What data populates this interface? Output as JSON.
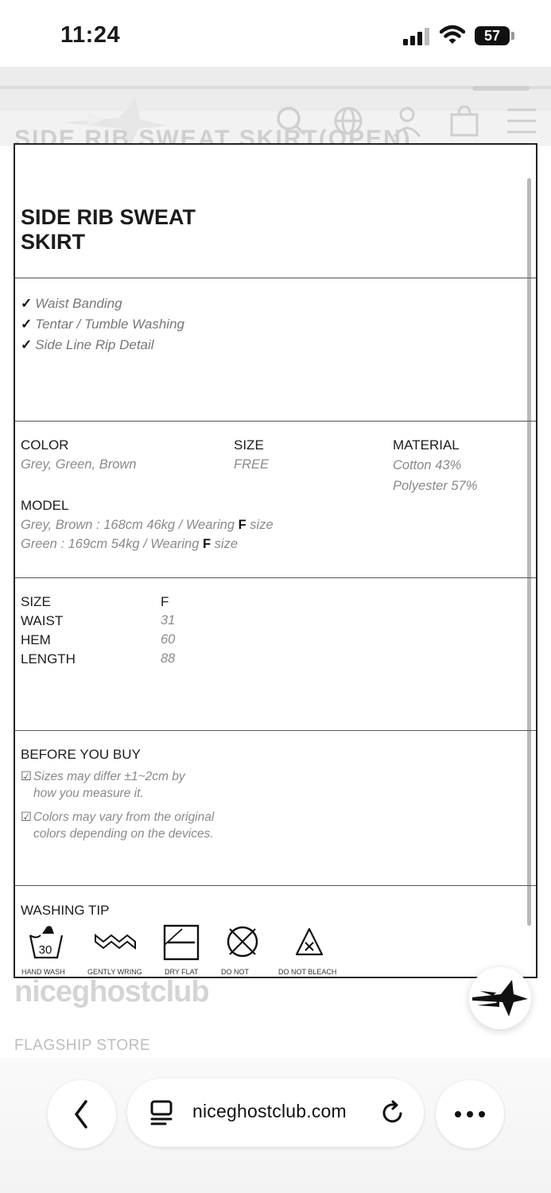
{
  "status_bar": {
    "time": "11:24",
    "battery": "57"
  },
  "site": {
    "header_ghost_text": "SIDE RIB SWEAT SKIRT(OPEN)",
    "brand_ghost": "niceghostclub",
    "flagship_label": "FLAGSHIP STORE"
  },
  "product": {
    "title": "SIDE RIB SWEAT SKIRT",
    "features": [
      "Waist Banding",
      "Tentar / Tumble Washing",
      "Side Line Rip Detail"
    ],
    "check": "✓"
  },
  "info": {
    "color_label": "COLOR",
    "color_value": "Grey, Green, Brown",
    "size_label": "SIZE",
    "size_value": "FREE",
    "material_label": "MATERIAL",
    "material_values": [
      "Cotton 43%",
      "Polyester 57%"
    ],
    "model_label": "MODEL",
    "model_lines": [
      {
        "prefix": "Grey, Brown : 168cm 46kg / Wearing ",
        "size": "F",
        "suffix": " size"
      },
      {
        "prefix": "Green : 169cm 54kg / Wearing ",
        "size": "F",
        "suffix": " size"
      }
    ]
  },
  "size_table": {
    "header_label": "SIZE",
    "header_value": "F",
    "rows": [
      {
        "label": "WAIST",
        "value": "31"
      },
      {
        "label": "HEM",
        "value": "60"
      },
      {
        "label": "LENGTH",
        "value": "88"
      }
    ]
  },
  "before_you_buy": {
    "title": "BEFORE YOU BUY",
    "checkbox": "☑",
    "notes": [
      {
        "line1": "Sizes may differ ±1~2cm by",
        "line2": "how you measure it."
      },
      {
        "line1": "Colors may vary from the original",
        "line2": "colors depending on the devices."
      }
    ]
  },
  "washing": {
    "title": "WASHING TIP",
    "wash_temp": "30",
    "items": [
      {
        "icon": "hand-wash-icon",
        "label": "HAND WASH"
      },
      {
        "icon": "gently-wring-icon",
        "label": "GENTLY WRING"
      },
      {
        "icon": "dry-flat-icon",
        "label": "DRY FLAT"
      },
      {
        "icon": "do-not-icon",
        "label": "DO NOT"
      },
      {
        "icon": "do-not-bleach-icon",
        "label": "DO NOT BLEACH"
      }
    ]
  },
  "browser": {
    "url": "niceghostclub.com"
  }
}
